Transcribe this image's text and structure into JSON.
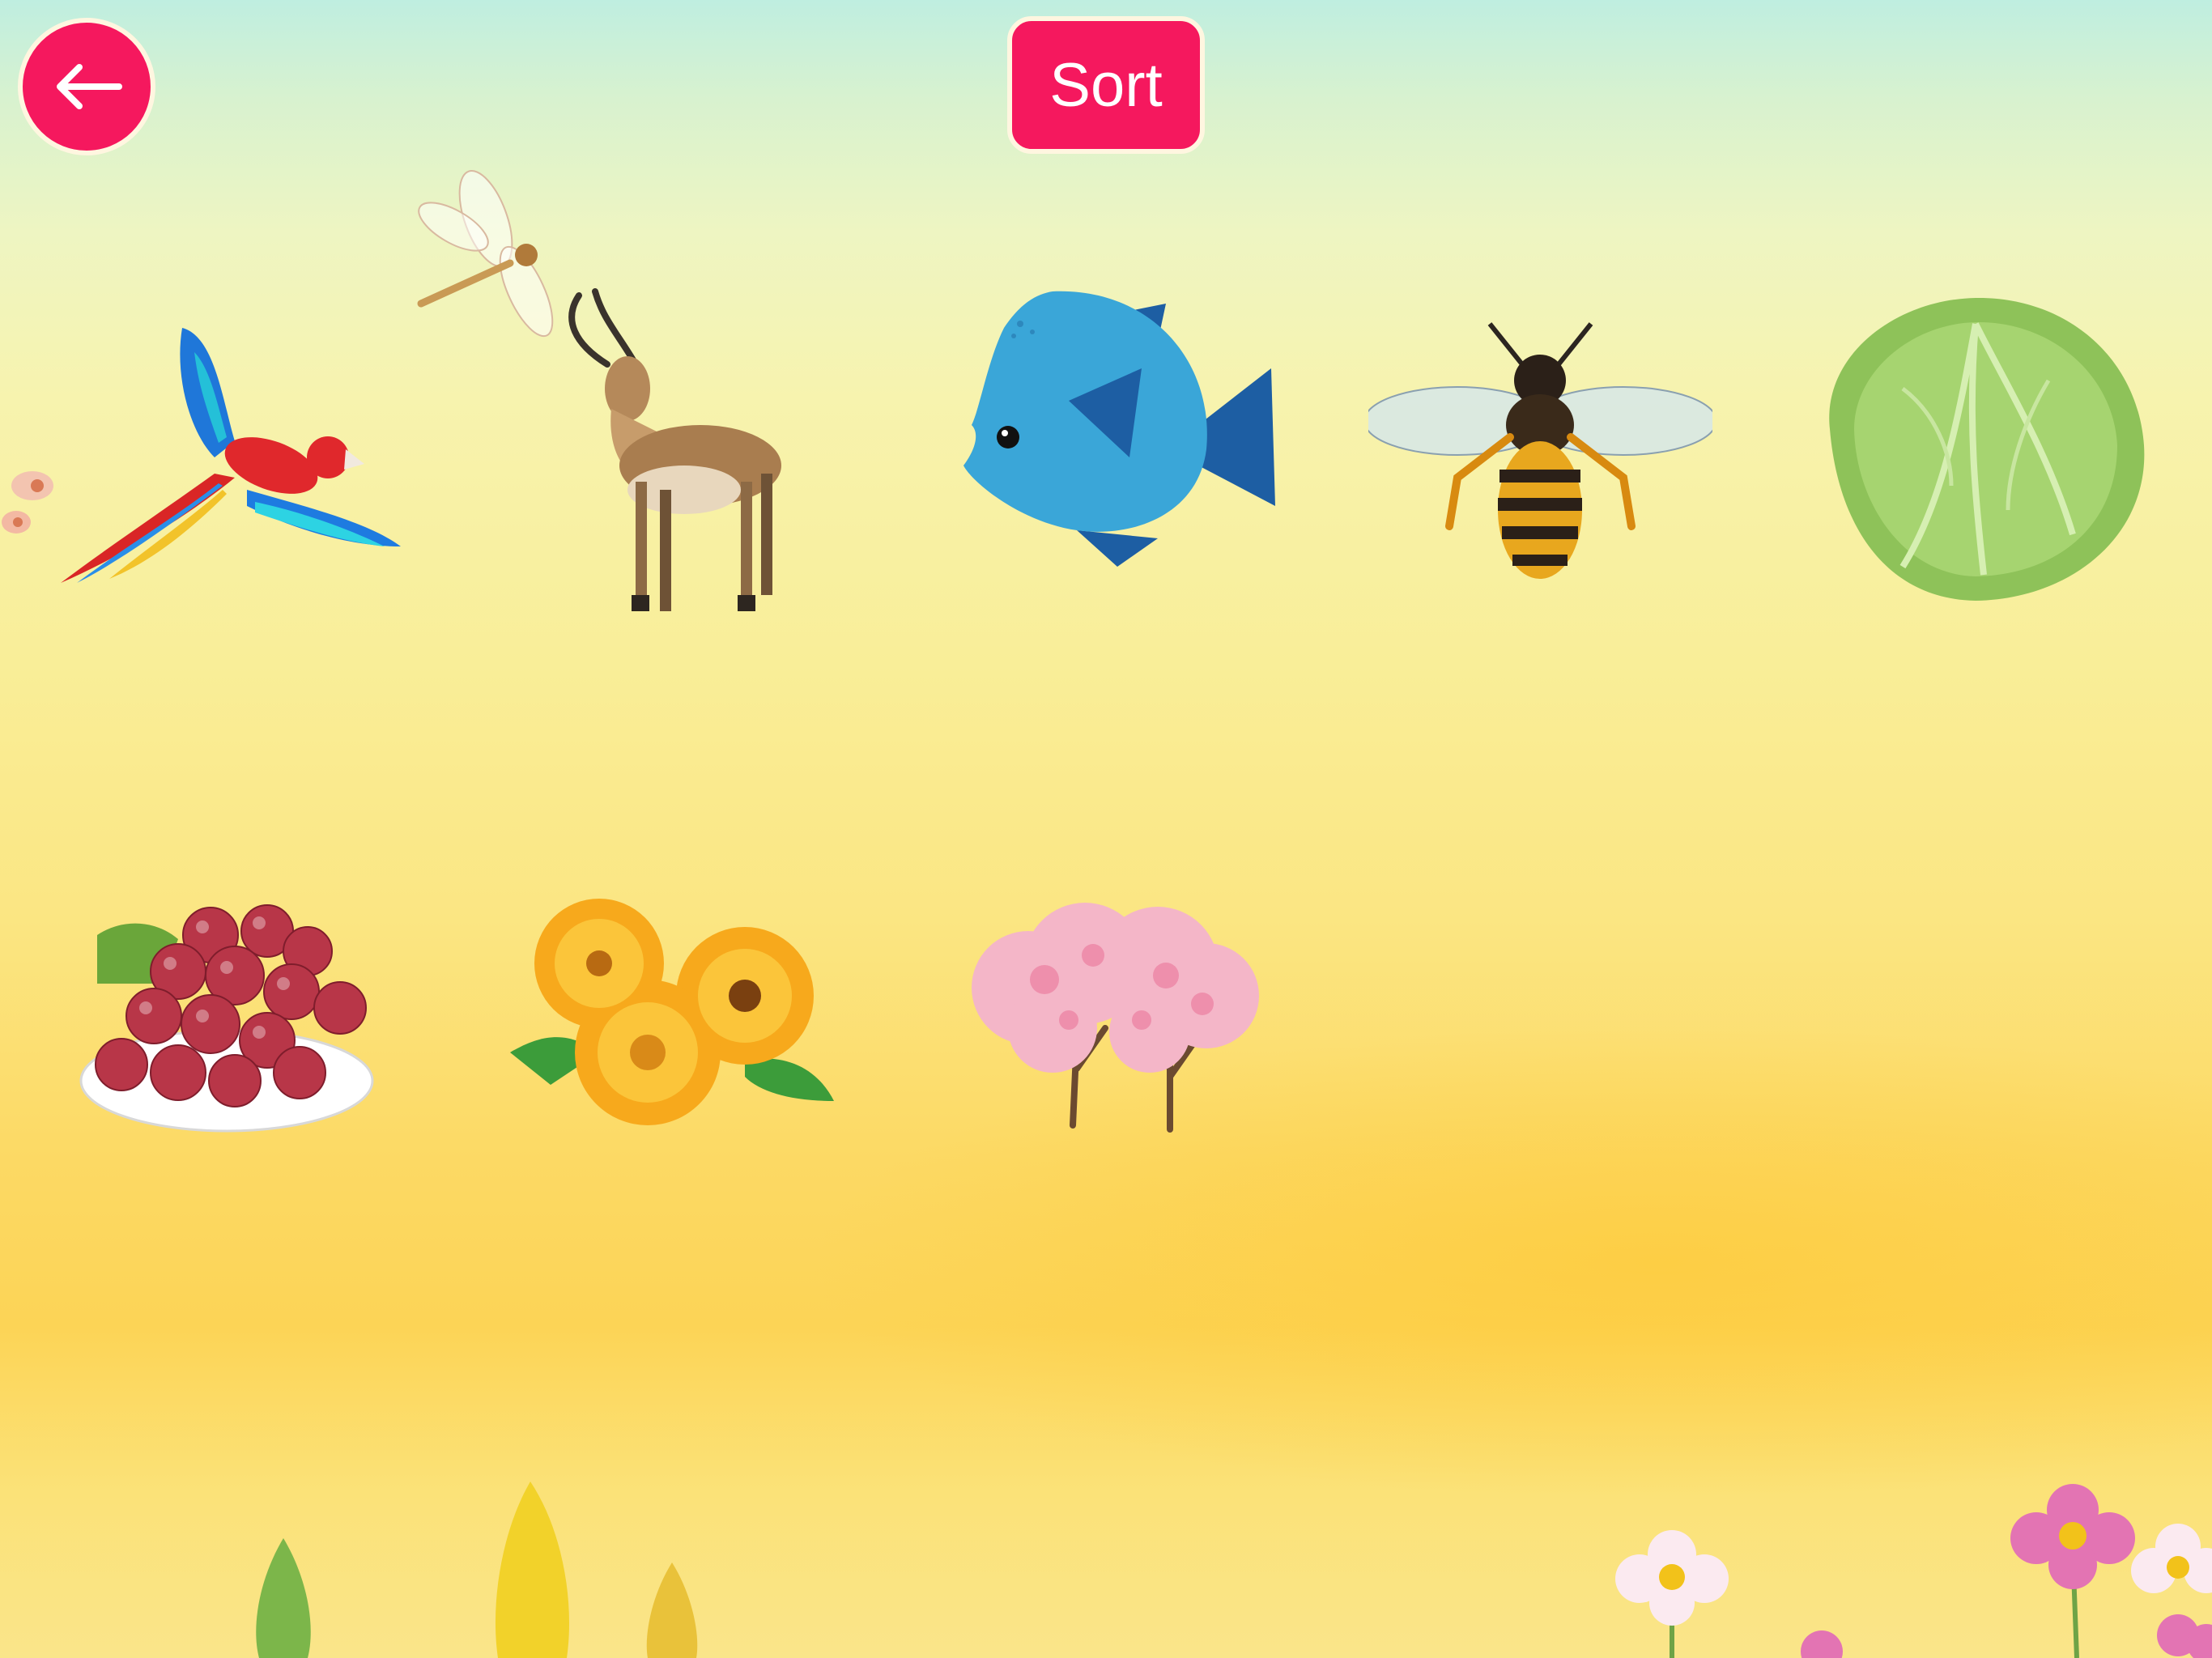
{
  "header": {
    "back_icon": "arrow-left-icon",
    "sort_label": "Sort",
    "accent_color": "#f5185e"
  },
  "items": [
    {
      "icon": "parrot-icon"
    },
    {
      "icon": "antelope-icon"
    },
    {
      "icon": "fish-icon"
    },
    {
      "icon": "bee-icon"
    },
    {
      "icon": "cabbage-icon"
    },
    {
      "icon": "grapes-icon"
    },
    {
      "icon": "marigold-flowers-icon"
    },
    {
      "icon": "cherry-blossom-trees-icon"
    }
  ]
}
